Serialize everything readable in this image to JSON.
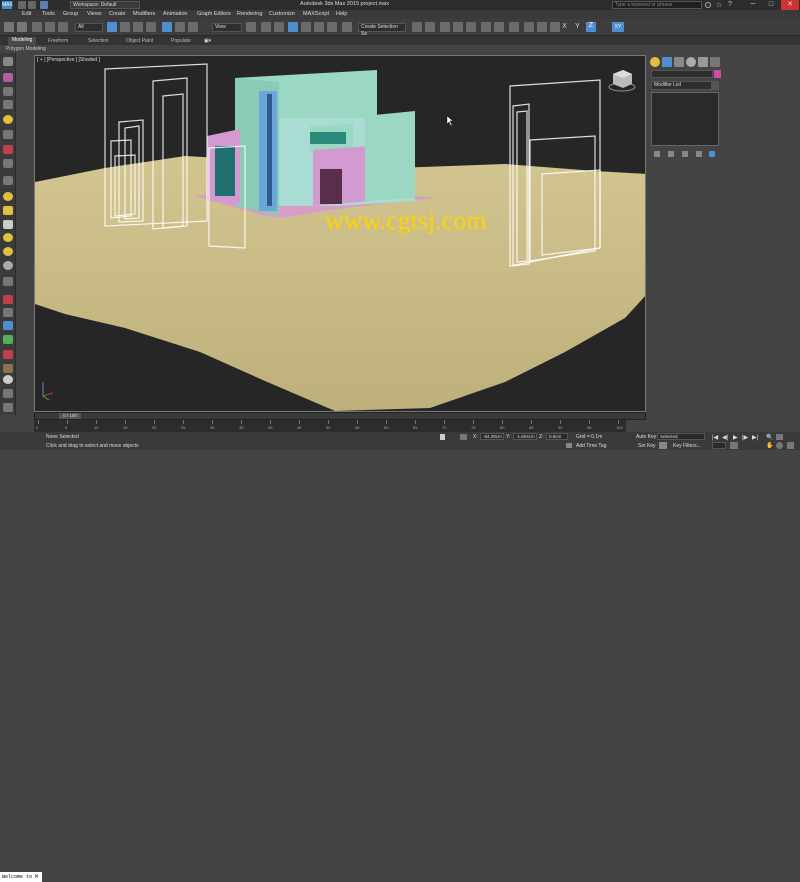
{
  "titlebar": {
    "app_icon": "MAX",
    "workspace": "Workspace: Default",
    "title": "Autodesk 3ds Max 2015      project.max",
    "search_placeholder": "Type a keyword or phrase",
    "minimize": "─",
    "maximize": "□",
    "close": "✕"
  },
  "menu": [
    "Edit",
    "Tools",
    "Group",
    "Views",
    "Create",
    "Modifiers",
    "Animation",
    "Graph Editors",
    "Rendering",
    "Customize",
    "MAXScript",
    "Help"
  ],
  "toolbar": {
    "filter_dropdown": "All",
    "view_dropdown": "View",
    "selection_set": "Create Selection Se",
    "axis_x": "X",
    "axis_y": "Y",
    "axis_z": "Z",
    "axis_xy": "XY"
  },
  "ribbon": {
    "tabs": [
      "Modeling",
      "Freeform",
      "Selection",
      "Object Paint",
      "Populate"
    ],
    "subtitle": "Polygon Modeling"
  },
  "viewport": {
    "label": "[ + ] [Perspective ] [Shaded ]",
    "watermark": "www.cgtsj.com"
  },
  "command_panel": {
    "modifier_list": "Modifier List"
  },
  "timeline": {
    "frame": "0 / 100",
    "ticks": [
      "0",
      "5",
      "10",
      "15",
      "20",
      "25",
      "30",
      "35",
      "40",
      "45",
      "50",
      "55",
      "60",
      "65",
      "70",
      "75",
      "80",
      "85",
      "90",
      "95",
      "100"
    ]
  },
  "status": {
    "console": "Welcome to M",
    "selection": "None Selected",
    "prompt": "Click and drag to select and move objects",
    "x_label": "X:",
    "x_value": "-84.28cm",
    "y_label": "Y:",
    "y_value": "-1.604cm",
    "z_label": "Z:",
    "z_value": "0.0cm",
    "grid": "Grid = 0.1m",
    "add_time_tag": "Add Time Tag",
    "auto_key": "Auto Key",
    "set_key": "Set Key",
    "key_mode": "Selected",
    "key_filters": "Key Filters..."
  },
  "colors": {
    "ground": "#cbbf8a",
    "building_cyan": "#9ad8c4",
    "building_pink": "#d29ad0",
    "watermark": "#ffd400"
  }
}
